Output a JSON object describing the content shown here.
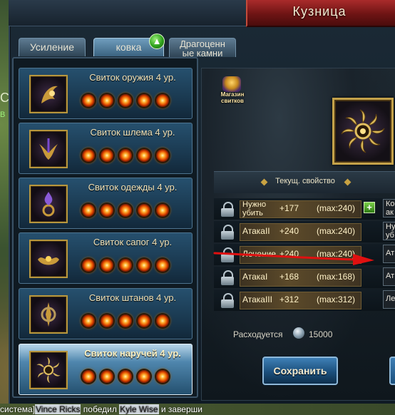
{
  "window": {
    "title": "Кузница"
  },
  "tabs": [
    {
      "label": "Усиление",
      "active": false
    },
    {
      "label": "ковка",
      "active": true
    },
    {
      "label_line1": "Драгоценн",
      "label_line2": "ые камни",
      "active": false
    }
  ],
  "scrolls": [
    {
      "name": "Свиток оружия 4 ур.",
      "icon": "weapon-emblem-icon",
      "orbs": 5,
      "selected": false
    },
    {
      "name": "Свиток шлема 4 ур.",
      "icon": "helmet-emblem-icon",
      "orbs": 5,
      "selected": false
    },
    {
      "name": "Свиток одежды 4 ур.",
      "icon": "armor-emblem-icon",
      "orbs": 5,
      "selected": false
    },
    {
      "name": "Свиток сапог 4 ур.",
      "icon": "boots-emblem-icon",
      "orbs": 5,
      "selected": false
    },
    {
      "name": "Свиток штанов 4 ур.",
      "icon": "pants-emblem-icon",
      "orbs": 5,
      "selected": false
    },
    {
      "name": "Свиток наручей 4 ур.",
      "icon": "bracers-emblem-icon",
      "orbs": 5,
      "selected": true
    }
  ],
  "shop": {
    "line1": "Магазин",
    "line2": "свитков"
  },
  "properties": {
    "header": "Текущ. свойство",
    "rows": [
      {
        "name_line1": "Нужно",
        "name_line2": "убить",
        "value": "+177",
        "max": "(max:240)",
        "side_line1": "Ко",
        "side_line2": "ак"
      },
      {
        "name": "АтакаII",
        "value": "+240",
        "max": "(max:240)",
        "side_line1": "Ну",
        "side_line2": "уб"
      },
      {
        "name": "Лечение",
        "value": "+240",
        "max": "(max:240)",
        "side": "Ат"
      },
      {
        "name": "АтакаI",
        "value": "+168",
        "max": "(max:168)",
        "side": "Ат"
      },
      {
        "name": "АтакаIII",
        "value": "+312",
        "max": "(max:312)",
        "side": "Ле"
      }
    ]
  },
  "cost": {
    "label": "Расходуется",
    "value": "15000"
  },
  "buttons": {
    "save": "Сохранить"
  },
  "chat": {
    "prefix": "система]",
    "name1": "Vince Ricks",
    "middle": " победил ",
    "name2": "Kyle Wise",
    "suffix": " и заверши"
  },
  "colors": {
    "title_red": "#a92b2b",
    "gold_frame": "#c4a24a",
    "arrow_red": "#e01010"
  }
}
